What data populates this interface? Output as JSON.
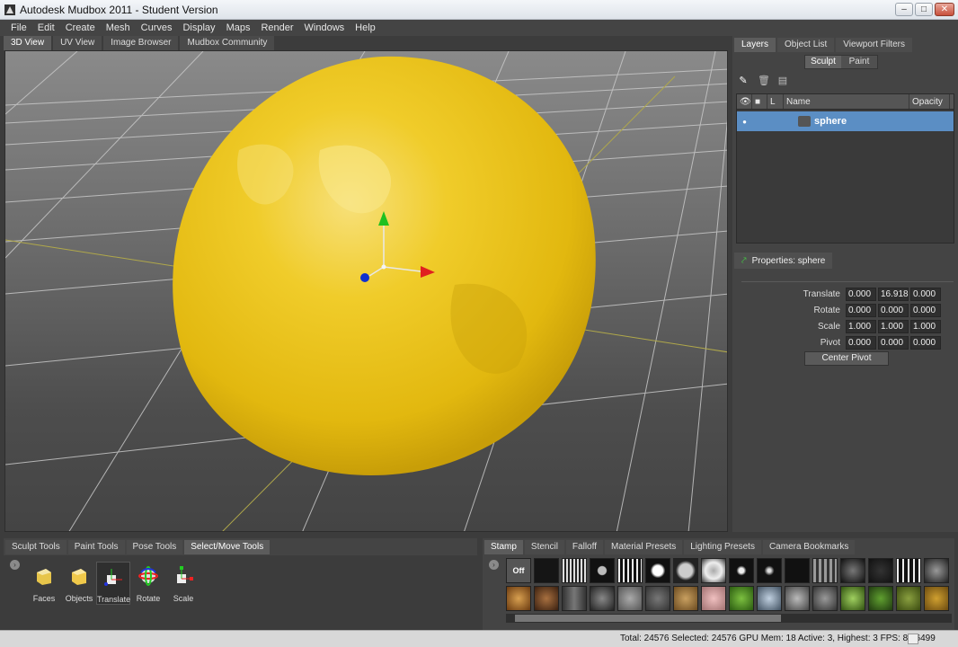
{
  "window": {
    "title": "Autodesk Mudbox 2011 - Student Version"
  },
  "menu": [
    "File",
    "Edit",
    "Create",
    "Mesh",
    "Curves",
    "Display",
    "Maps",
    "Render",
    "Windows",
    "Help"
  ],
  "view_tabs": [
    "3D View",
    "UV View",
    "Image Browser",
    "Mudbox Community"
  ],
  "right_panel": {
    "tabs": [
      "Layers",
      "Object List",
      "Viewport Filters"
    ],
    "mode_tabs": [
      "Sculpt",
      "Paint"
    ],
    "layer_columns": [
      "L",
      "Name",
      "Opacity"
    ],
    "layer_row": {
      "name": "sphere"
    },
    "properties_title": "Properties: sphere",
    "translate": {
      "label": "Translate",
      "x": "0.000",
      "y": "16.918",
      "z": "0.000"
    },
    "rotate": {
      "label": "Rotate",
      "x": "0.000",
      "y": "0.000",
      "z": "0.000"
    },
    "scale": {
      "label": "Scale",
      "x": "1.000",
      "y": "1.000",
      "z": "1.000"
    },
    "pivot": {
      "label": "Pivot",
      "x": "0.000",
      "y": "0.000",
      "z": "0.000"
    },
    "center_pivot": "Center Pivot"
  },
  "tool_tabs": [
    "Sculpt Tools",
    "Paint Tools",
    "Pose Tools",
    "Select/Move Tools"
  ],
  "tools": [
    "Faces",
    "Objects",
    "Translate",
    "Rotate",
    "Scale"
  ],
  "tray_tabs": [
    "Stamp",
    "Stencil",
    "Falloff",
    "Material Presets",
    "Lighting Presets",
    "Camera Bookmarks"
  ],
  "stamp_off_label": "Off",
  "status": {
    "text": "Total: 24576  Selected: 24576 GPU Mem: 18  Active: 3, Highest: 3  FPS: 89.6499"
  },
  "colors": {
    "sphere": "#e8c21a",
    "selection": "#5b8ec4",
    "axis_x": "#e02020",
    "axis_y": "#20c020",
    "axis_z": "#1030d0"
  }
}
